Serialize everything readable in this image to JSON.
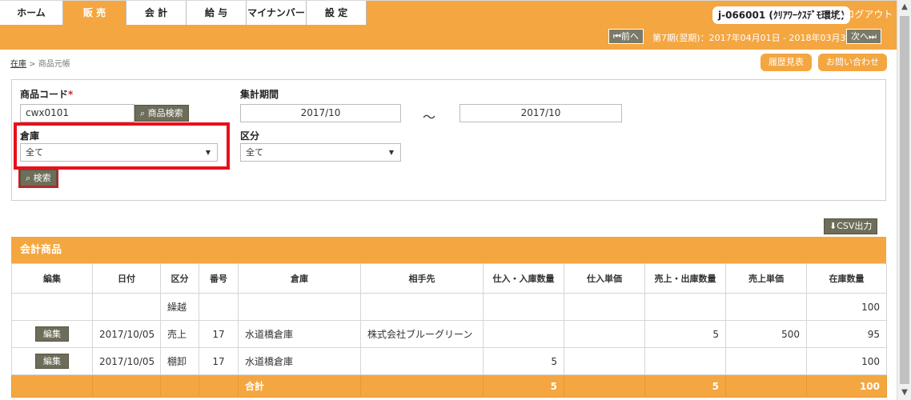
{
  "nav": {
    "tabs": [
      {
        "label": "ホーム"
      },
      {
        "label": "販 売"
      },
      {
        "label": "会 計"
      },
      {
        "label": "給 与"
      },
      {
        "label": "マイナンバー"
      },
      {
        "label": "設 定"
      }
    ],
    "user_badge": "j-066001 (ｸﾘｱﾜｰｸｽﾃﾞﾓ環境)",
    "logout": "ログアウト"
  },
  "period_bar": {
    "prev": "前へ",
    "period": "第7期(翌期)：2017年04月01日 - 2018年03月31日",
    "next": "次へ"
  },
  "breadcrumb": {
    "link": "在庫",
    "separator": ">",
    "current": "商品元帳"
  },
  "actions": {
    "history": "履歴見表",
    "contact": "お問い合わせ"
  },
  "search": {
    "product_code_label": "商品コード",
    "required_mark": "*",
    "product_code_value": "cwx0101",
    "product_search_button": "商品検索",
    "period_label": "集計期間",
    "period_from": "2017/10",
    "period_sep": "～",
    "period_to": "2017/10",
    "warehouse_label": "倉庫",
    "warehouse_value": "全て",
    "division_label": "区分",
    "division_value": "全て",
    "search_button": "検索"
  },
  "csv_button": "CSV出力",
  "table": {
    "title": "会計商品",
    "headers": [
      "編集",
      "日付",
      "区分",
      "番号",
      "倉庫",
      "相手先",
      "仕入・入庫数量",
      "仕入単価",
      "売上・出庫数量",
      "売上単価",
      "在庫数量"
    ],
    "rows": [
      {
        "edit": "",
        "date": "",
        "div": "繰越",
        "num": "",
        "wh": "",
        "partner": "",
        "in_qty": "",
        "in_price": "",
        "out_qty": "",
        "out_price": "",
        "stock": "100"
      },
      {
        "edit": "編集",
        "date": "2017/10/05",
        "div": "売上",
        "num": "17",
        "wh": "水道橋倉庫",
        "partner": "株式会社ブルーグリーン",
        "in_qty": "",
        "in_price": "",
        "out_qty": "5",
        "out_price": "500",
        "stock": "95"
      },
      {
        "edit": "編集",
        "date": "2017/10/05",
        "div": "棚卸",
        "num": "17",
        "wh": "水道橋倉庫",
        "partner": "",
        "in_qty": "5",
        "in_price": "",
        "out_qty": "",
        "out_price": "",
        "stock": "100"
      }
    ],
    "total": {
      "label": "合計",
      "in_qty": "5",
      "out_qty": "5",
      "stock": "100"
    }
  }
}
